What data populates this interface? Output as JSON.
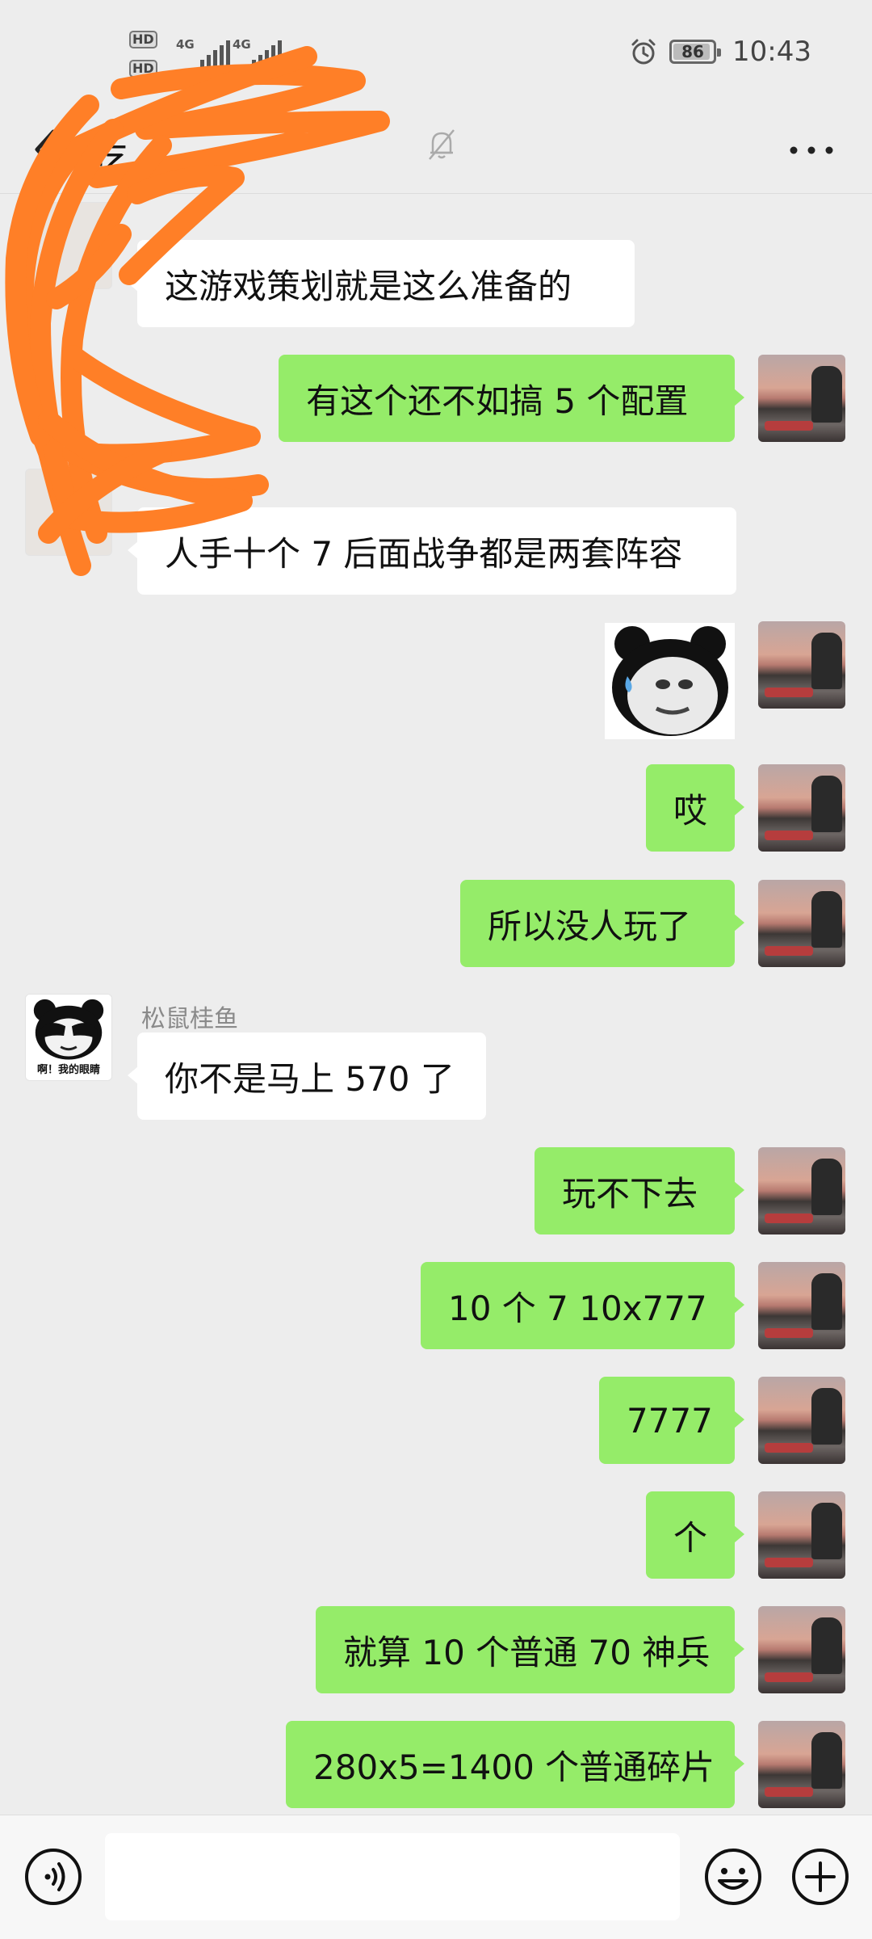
{
  "status_bar": {
    "sim1_badge": "HD",
    "sim2_badge": "HD",
    "network1": "4G",
    "network2": "4G",
    "battery": "86",
    "time": "10:43"
  },
  "header": {
    "title": "吃"
  },
  "sticker_caption": "啊！我的眼睛",
  "messages": [
    {
      "side": "left",
      "text": "这游戏策划就是这么准备的"
    },
    {
      "side": "right",
      "text": "有这个还不如搞 5 个配置"
    },
    {
      "side": "left",
      "text": "人手十个 7  后面战争都是两套阵容"
    },
    {
      "side": "right",
      "type": "sticker"
    },
    {
      "side": "right",
      "text": "哎"
    },
    {
      "side": "right",
      "text": "所以没人玩了"
    },
    {
      "side": "left",
      "sender": "松鼠桂鱼",
      "text": "你不是马上 570 了"
    },
    {
      "side": "right",
      "text": "玩不下去"
    },
    {
      "side": "right",
      "text": "10 个 7   10x777"
    },
    {
      "side": "right",
      "text": "7777"
    },
    {
      "side": "right",
      "text": "个"
    },
    {
      "side": "right",
      "text": "就算 10 个普通 70 神兵"
    },
    {
      "side": "right",
      "text": "280x5=1400 个普通碎片"
    }
  ],
  "input": {
    "value": "",
    "placeholder": ""
  },
  "icons": {
    "back": "chevron-left-icon",
    "mute": "bell-off-icon",
    "more": "more-horizontal-icon",
    "voice": "voice-icon",
    "emoji": "emoji-icon",
    "plus": "plus-circle-icon"
  },
  "colors": {
    "background": "#ededed",
    "self_bubble": "#95ec69",
    "other_bubble": "#ffffff",
    "scribble": "#ff7f27"
  }
}
